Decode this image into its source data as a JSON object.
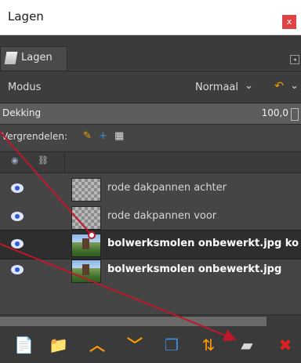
{
  "window": {
    "title": "Lagen",
    "close_label": "x"
  },
  "tab": {
    "label": "Lagen",
    "icon": "layers-tab-icon",
    "menu_icon": "tab-menu-icon"
  },
  "mode": {
    "label": "Modus",
    "value": "Normaal",
    "chevron": "⌄",
    "extra_icon": "↶"
  },
  "opacity": {
    "label": "Dekking",
    "value": "100,0"
  },
  "lock": {
    "label": "Vergrendelen:",
    "icons": [
      "✎",
      "+",
      "▦"
    ]
  },
  "list_header": {
    "eye_icon": "eye-header-icon",
    "chain_icon": "chain-header-icon"
  },
  "layers": [
    {
      "name": "rode dakpannen achter",
      "thumb": "checker",
      "visible": true,
      "bold": false
    },
    {
      "name": "rode dakpannen voor",
      "thumb": "checker",
      "visible": true,
      "bold": false
    },
    {
      "name": "bolwerksmolen onbewerkt.jpg ko",
      "thumb": "photo",
      "visible": true,
      "bold": true
    },
    {
      "name": "bolwerksmolen onbewerkt.jpg",
      "thumb": "photo",
      "visible": true,
      "bold": true
    }
  ],
  "toolbar": {
    "buttons": [
      {
        "name": "new-layer-icon",
        "glyph": "📄",
        "color": "#ffffff"
      },
      {
        "name": "new-layer-group-icon",
        "glyph": "📁",
        "color": "#2f87c8"
      },
      {
        "name": "raise-layer-icon",
        "glyph": "︿",
        "color": "#ff9a00"
      },
      {
        "name": "lower-layer-icon",
        "glyph": "﹀",
        "color": "#ff9a00"
      },
      {
        "name": "duplicate-layer-icon",
        "glyph": "❐",
        "color": "#3a8ede"
      },
      {
        "name": "merge-down-icon",
        "glyph": "⇅",
        "color": "#ff9a00"
      },
      {
        "name": "anchor-layer-icon",
        "glyph": "▰",
        "color": "#d8d8d8"
      },
      {
        "name": "delete-layer-icon",
        "glyph": "✖",
        "color": "#e01f1f"
      }
    ]
  },
  "colors": {
    "background": "#454545",
    "accent_orange": "#ff9a00",
    "annotation_red": "#c0172a"
  }
}
